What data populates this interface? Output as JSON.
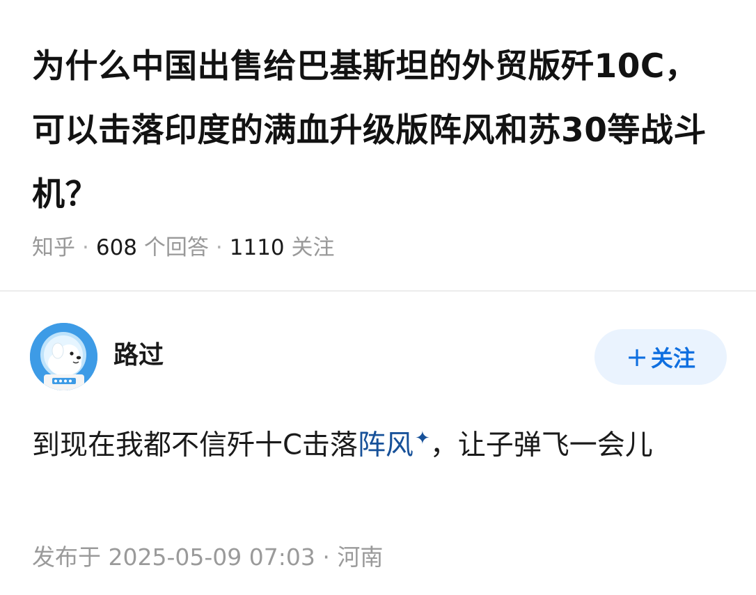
{
  "question": {
    "title": "为什么中国出售给巴基斯坦的外贸版歼10C，可以击落印度的满血升级版阵风和苏30等战斗机？",
    "source": "知乎",
    "answer_count": "608",
    "answer_suffix": "个回答",
    "follower_count": "1110",
    "follower_suffix": "关注",
    "separator": "·"
  },
  "answer": {
    "author_name": "路过",
    "avatar_icon": "astronaut-dog-avatar",
    "follow_plus": "+",
    "follow_label": "关注",
    "content_before": "到现在我都不信歼十C击落",
    "content_link": "阵风",
    "content_link_icon": "sparkle-icon",
    "content_after": "，让子弹飞一会儿",
    "publish_prefix": "发布于",
    "publish_datetime": "2025-05-09 07:03",
    "publish_separator": "·",
    "publish_location": "河南"
  },
  "colors": {
    "link": "#175199",
    "follow_text": "#0f6fe0",
    "follow_bg": "#eaf3fe",
    "meta_gray": "#999999"
  }
}
